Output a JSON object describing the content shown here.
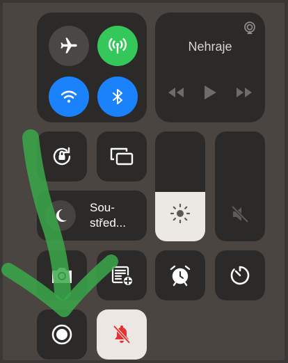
{
  "media": {
    "title": "Nehraje",
    "airplay_icon": "airplay-icon",
    "controls": [
      "rewind-icon",
      "play-icon",
      "fast-forward-icon"
    ]
  },
  "connectivity": {
    "airplane": {
      "icon": "airplane-icon",
      "active": false
    },
    "cellular": {
      "icon": "cellular-antenna-icon",
      "active": true,
      "color": "#34c759"
    },
    "wifi": {
      "icon": "wifi-icon",
      "active": true,
      "color": "#1a82fb"
    },
    "bluetooth": {
      "icon": "bluetooth-icon",
      "active": true,
      "color": "#1a82fb"
    }
  },
  "focus": {
    "label_line1": "Sou-",
    "label_line2": "střed..."
  },
  "sliders": {
    "brightness": {
      "level": 0.45,
      "icon": "sun-icon"
    },
    "volume": {
      "level": 0.0,
      "icon": "speaker-muted-icon"
    }
  },
  "silent_mode": {
    "icon": "bell-slash-icon",
    "color": "#e5312f"
  },
  "colors": {
    "tile": "#2c2a28",
    "background": "#4a4541",
    "annotation_arrow": "#3aa84a"
  }
}
